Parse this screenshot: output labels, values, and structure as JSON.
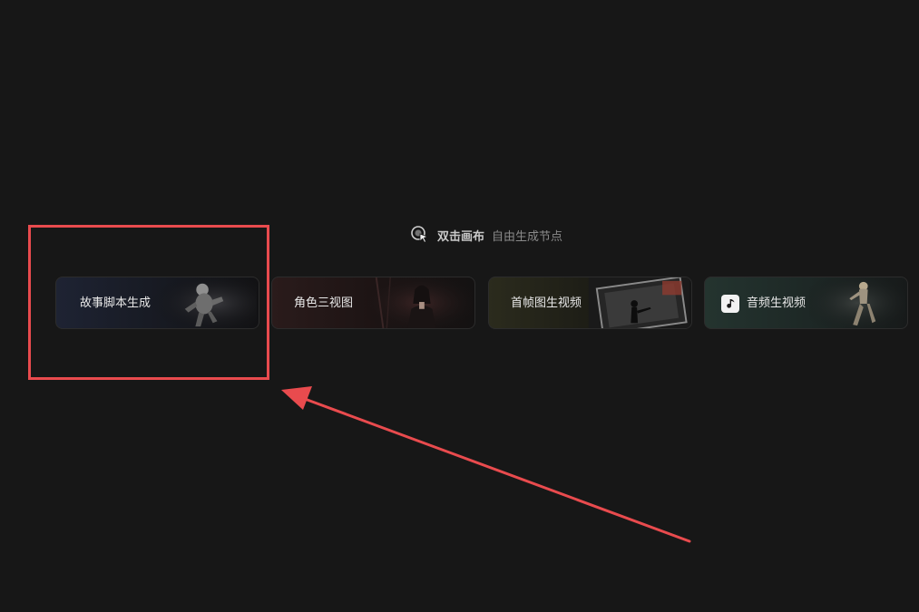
{
  "canvas_hint": {
    "strong": "双击画布",
    "rest": "自由生成节点",
    "icon": "cursor-click-icon"
  },
  "cards": [
    {
      "label": "故事脚本生成",
      "art": "astronaut-illustration"
    },
    {
      "label": "角色三视图",
      "art": "portrait-illustration"
    },
    {
      "label": "首帧图生视频",
      "art": "frames-illustration"
    },
    {
      "label": "音频生视频",
      "art": "dancer-illustration",
      "icon": "music-note-icon"
    }
  ],
  "annotation": {
    "highlight_color": "#e94b4e",
    "highlighted_card": "故事脚本生成"
  }
}
